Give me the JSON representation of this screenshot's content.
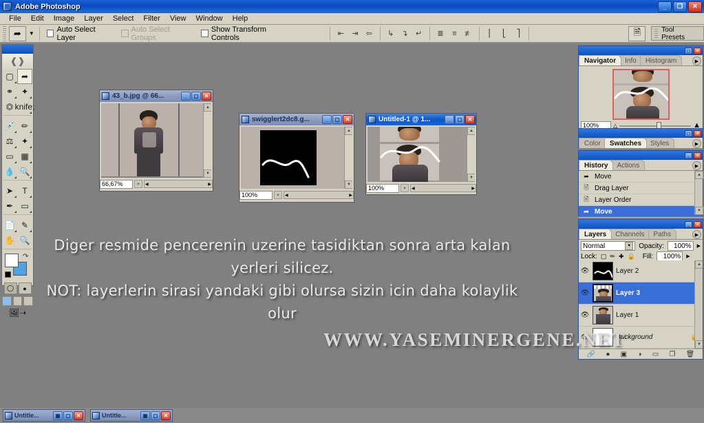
{
  "app": {
    "title": "Adobe Photoshop",
    "window_buttons": {
      "minimize": "_",
      "restore": "❐",
      "close": "✕"
    }
  },
  "menubar": {
    "items": [
      "File",
      "Edit",
      "Image",
      "Layer",
      "Select",
      "Filter",
      "View",
      "Window",
      "Help"
    ]
  },
  "options_bar": {
    "tool_icon": "move-tool-icon",
    "auto_select_layer": "Auto Select Layer",
    "auto_select_groups": "Auto Select Groups",
    "show_transform_controls": "Show Transform Controls",
    "align_icons": [
      "align-top-edges",
      "align-vertical-centers",
      "align-bottom-edges",
      "align-left-edges",
      "align-horizontal-centers",
      "align-right-edges"
    ],
    "distribute_icons": [
      "distribute-top-edges",
      "distribute-vertical-centers",
      "distribute-bottom-edges",
      "distribute-left-edges",
      "distribute-horizontal-centers",
      "distribute-right-edges"
    ],
    "tool_presets_label": "Tool Presets"
  },
  "toolbox": {
    "tools": [
      [
        "marquee-tool",
        "move-tool"
      ],
      [
        "lasso-tool",
        "magic-wand-tool"
      ],
      [
        "crop-tool",
        "slice-tool"
      ],
      [
        "healing-brush-tool",
        "brush-tool"
      ],
      [
        "clone-stamp-tool",
        "history-brush-tool"
      ],
      [
        "eraser-tool",
        "gradient-tool"
      ],
      [
        "blur-tool",
        "dodge-tool"
      ],
      [
        "path-selection-tool",
        "type-tool"
      ],
      [
        "pen-tool",
        "shape-tool"
      ],
      [
        "notes-tool",
        "eyedropper-tool"
      ],
      [
        "hand-tool",
        "zoom-tool"
      ]
    ],
    "foreground_color": "#ffffff",
    "background_color": "#4fa3e3",
    "quick_mask_modes": [
      "standard-mode",
      "quick-mask-mode"
    ],
    "screen_modes": [
      "standard-screen-mode",
      "full-screen-with-menu",
      "full-screen-mode"
    ],
    "jump_to": "jump-to-imageready"
  },
  "documents": [
    {
      "title": "43_b.jpg @ 66...",
      "zoom": "66,67%",
      "active": false
    },
    {
      "title": "swigglert2dc8.g...",
      "zoom": "100%",
      "active": false
    },
    {
      "title": "Untitled-1 @ 1...",
      "zoom": "100%",
      "active": true
    }
  ],
  "palettes": {
    "navigator": {
      "tabs": [
        "Navigator",
        "Info",
        "Histogram"
      ],
      "active_tab": "Navigator",
      "zoom_value": "100%"
    },
    "color": {
      "tabs": [
        "Color",
        "Swatches",
        "Styles"
      ],
      "active_tab": "Swatches"
    },
    "history": {
      "tabs": [
        "History",
        "Actions"
      ],
      "active_tab": "History",
      "items": [
        {
          "label": "Move",
          "icon": "move-tool-icon",
          "selected": false
        },
        {
          "label": "Drag Layer",
          "icon": "layer-icon",
          "selected": false
        },
        {
          "label": "Layer Order",
          "icon": "layer-icon",
          "selected": false
        },
        {
          "label": "Move",
          "icon": "move-tool-icon",
          "selected": true
        }
      ]
    },
    "layers": {
      "tabs": [
        "Layers",
        "Channels",
        "Paths"
      ],
      "active_tab": "Layers",
      "blend_mode": "Normal",
      "opacity_label": "Opacity:",
      "opacity_value": "100%",
      "lock_label": "Lock:",
      "lock_icons": [
        "lock-transparency-icon",
        "lock-image-icon",
        "lock-position-icon",
        "lock-all-icon"
      ],
      "fill_label": "Fill:",
      "fill_value": "100%",
      "layers": [
        {
          "name": "Layer 2",
          "visible": true,
          "selected": false,
          "locked": false,
          "thumb": "squiggle-on-black"
        },
        {
          "name": "Layer 3",
          "visible": true,
          "selected": true,
          "locked": false,
          "thumb": "portrait-with-squiggle"
        },
        {
          "name": "Layer 1",
          "visible": true,
          "selected": false,
          "locked": false,
          "thumb": "portrait"
        },
        {
          "name": "Background",
          "visible": true,
          "selected": false,
          "locked": true,
          "thumb": "white"
        }
      ],
      "footer_icons": [
        "link-layers-icon",
        "layer-style-icon",
        "layer-mask-icon",
        "adjustment-layer-icon",
        "new-group-icon",
        "new-layer-icon",
        "delete-layer-icon"
      ]
    }
  },
  "overlay": {
    "tutorial_lines": [
      "Diger resmide pencerenin uzerine tasidiktan sonra arta kalan",
      "yerleri silicez.",
      "NOT: layerlerin sirasi  yandaki gibi olursa sizin icin daha kolaylik",
      "olur"
    ],
    "watermark": "WWW.YASEMINERGENE.NET"
  },
  "taskbar": {
    "minimized_windows": [
      {
        "title": "Untitle...",
        "buttons": [
          "▣",
          "❐",
          "✕"
        ]
      },
      {
        "title": "Untitle...",
        "buttons": [
          "▣",
          "❐",
          "✕"
        ]
      }
    ]
  },
  "colors": {
    "titlebar_blue": "#0a4bbd",
    "canvas_gray": "#808080",
    "palette_bg": "#d6d2c4",
    "selection_blue": "#3a6fd8"
  }
}
